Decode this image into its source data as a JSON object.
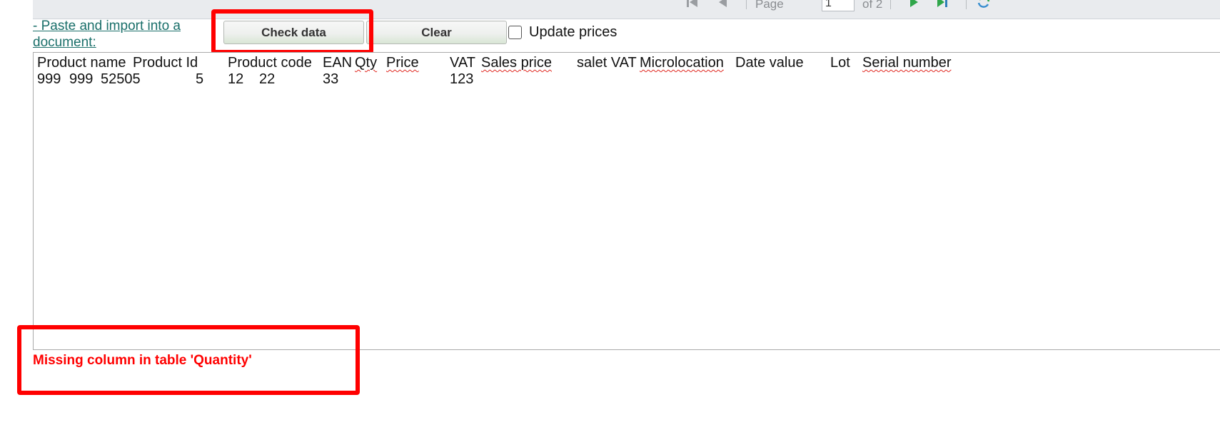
{
  "pager": {
    "page_label": "Page",
    "page_value": "1",
    "of_label": "of 2"
  },
  "import_link": "- Paste and import into a document:",
  "buttons": {
    "check_data": "Check data",
    "clear": "Clear"
  },
  "update_prices": {
    "label": "Update prices",
    "checked": false
  },
  "paste_table": {
    "headers": [
      "Product name",
      "Product Id",
      "Product code",
      "EAN",
      "Qty",
      "Price",
      "VAT",
      "Sales price",
      "salet VAT",
      "Microlocation",
      "Date value",
      "Lot",
      "Serial number"
    ],
    "row": [
      "999",
      "999",
      "52505",
      "5",
      "12",
      "22",
      "33",
      "123"
    ]
  },
  "error": "Missing column in table 'Quantity'",
  "colors": {
    "highlight": "#ff0000",
    "link": "#1a6f6a",
    "error": "#ff0000"
  },
  "icons": [
    "first-page-icon",
    "previous-page-icon",
    "next-page-icon",
    "last-page-icon",
    "refresh-icon"
  ]
}
